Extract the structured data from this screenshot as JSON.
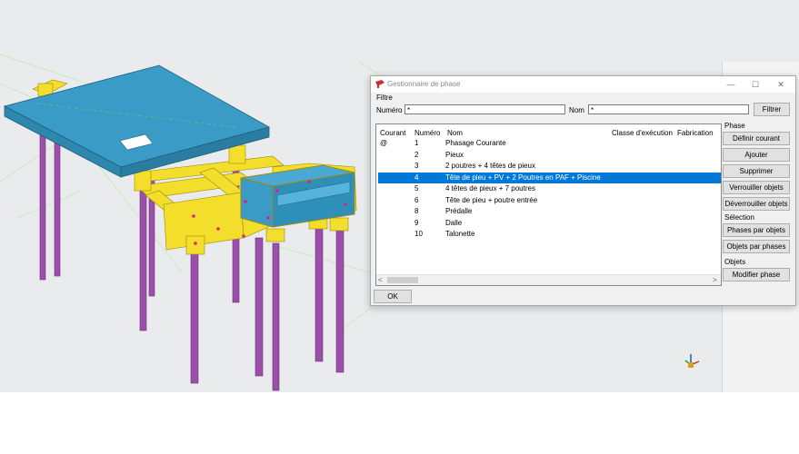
{
  "dialog": {
    "title": "Gestionnaire de phase",
    "controls": {
      "minimize": "—",
      "maximize": "☐",
      "close": "✕"
    },
    "filter": {
      "group_label": "Filtre",
      "numero_label": "Numéro",
      "numero_value": "*",
      "nom_label": "Nom",
      "nom_value": "*",
      "filter_button": "Filtrer"
    },
    "columns": {
      "courant": "Courant",
      "numero": "Numéro",
      "nom": "Nom",
      "classe": "Classe d'exécution",
      "fabrication": "Fabrication"
    },
    "rows": [
      {
        "courant": "@",
        "numero": "1",
        "nom": "Phasage Courante",
        "selected": false
      },
      {
        "courant": "",
        "numero": "2",
        "nom": "Pieux",
        "selected": false
      },
      {
        "courant": "",
        "numero": "3",
        "nom": "2 poutres + 4 têtes de pieux",
        "selected": false
      },
      {
        "courant": "",
        "numero": "4",
        "nom": "Tête de pieu + PV + 2 Poutres en PAF + Piscine",
        "selected": true
      },
      {
        "courant": "",
        "numero": "5",
        "nom": "4 têtes de pieux + 7 poutres",
        "selected": false
      },
      {
        "courant": "",
        "numero": "6",
        "nom": "Tête de pieu + poutre entrée",
        "selected": false
      },
      {
        "courant": "",
        "numero": "8",
        "nom": "Prédalle",
        "selected": false
      },
      {
        "courant": "",
        "numero": "9",
        "nom": "Dalle",
        "selected": false
      },
      {
        "courant": "",
        "numero": "10",
        "nom": "Talonette",
        "selected": false
      }
    ],
    "phase_group": {
      "label": "Phase",
      "buttons": [
        "Définir courant",
        "Ajouter",
        "Supprimer",
        "Verrouiller objets",
        "Déverrouiller objets"
      ]
    },
    "selection_group": {
      "label": "Sélection",
      "buttons": [
        "Phases par objets",
        "Objets par phases"
      ]
    },
    "objets_group": {
      "label": "Objets",
      "buttons": [
        "Modifier phase"
      ]
    },
    "ok_button": "OK",
    "scroll_left": "<",
    "scroll_right": ">"
  },
  "colors": {
    "selection": "#0078d7",
    "slab": "#3a9bc6",
    "beam": "#f2de2b",
    "pile": "#9a4fa8",
    "viewport_bg": "#e9ebec"
  },
  "icons": {
    "app": "tekla-app-icon",
    "axis": "axis-gizmo-icon"
  }
}
